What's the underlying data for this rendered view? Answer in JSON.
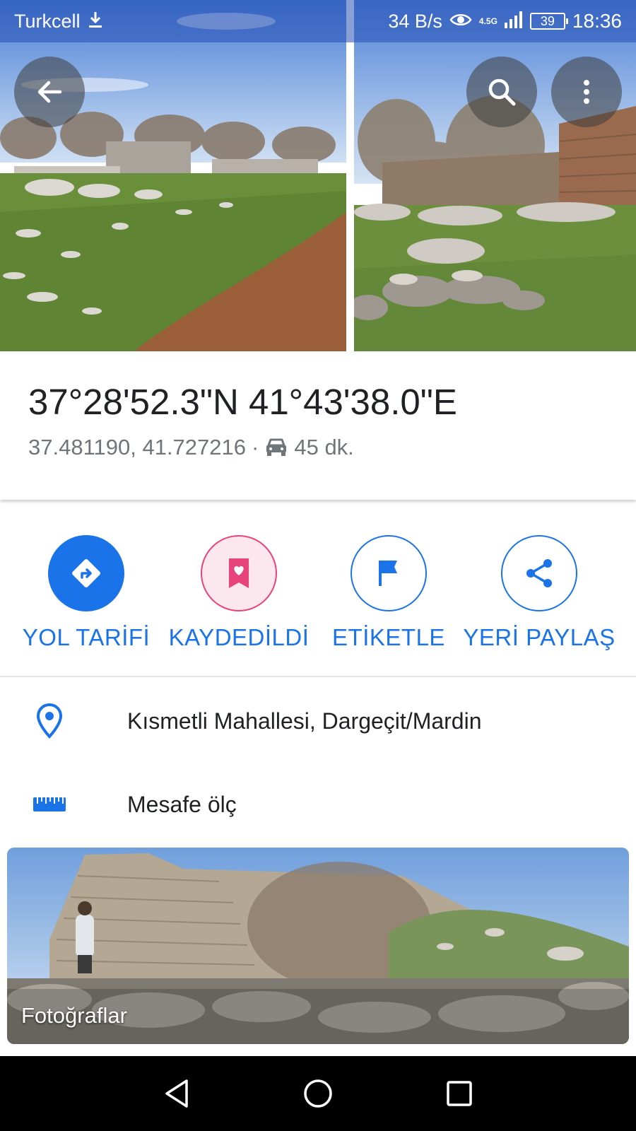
{
  "status_bar": {
    "carrier": "Turkcell",
    "net_speed": "34 B/s",
    "net_type": "4.5G",
    "battery": "39",
    "time": "18:36"
  },
  "header": {
    "icons": [
      "back-arrow-icon",
      "search-icon",
      "more-vert-icon"
    ]
  },
  "place": {
    "title": "37°28'52.3\"N 41°43'38.0\"E",
    "coordinates": "37.481190, 41.727216",
    "separator": "·",
    "drive_time": "45 dk."
  },
  "actions": [
    {
      "label": "YOL TARİFİ",
      "icon": "directions-icon"
    },
    {
      "label": "KAYDEDİLDİ",
      "icon": "saved-bookmark-icon"
    },
    {
      "label": "ETİKETLE",
      "icon": "flag-icon"
    },
    {
      "label": "YERİ PAYLAŞ",
      "icon": "share-icon"
    }
  ],
  "info_rows": {
    "address": "Kısmetli Mahallesi, Dargeçit/Mardin",
    "measure": "Mesafe ölç"
  },
  "photos_card": {
    "label": "Fotoğraflar"
  },
  "colors": {
    "accent": "#1a73e8",
    "saved_pink": "#e8437a",
    "text_primary": "#202124",
    "text_secondary": "#70757a"
  },
  "nav_bar": {
    "icons": [
      "nav-back-icon",
      "nav-home-icon",
      "nav-recent-icon"
    ]
  }
}
